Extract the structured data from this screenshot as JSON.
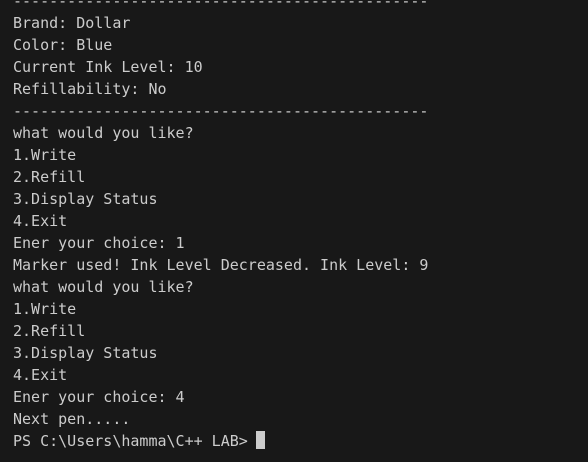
{
  "terminal": {
    "lines": [
      "----------------------------------------------",
      "Brand: Dollar",
      "Color: Blue",
      "Current Ink Level: 10",
      "Refillability: No",
      "----------------------------------------------",
      "what would you like?",
      "1.Write",
      "2.Refill",
      "3.Display Status",
      "4.Exit",
      "Ener your choice: 1",
      "Marker used! Ink Level Decreased. Ink Level: 9",
      "what would you like?",
      "1.Write",
      "2.Refill",
      "3.Display Status",
      "4.Exit",
      "Ener your choice: 4",
      "Next pen.....",
      "PS C:\\Users\\hamma\\C++ LAB>"
    ]
  }
}
